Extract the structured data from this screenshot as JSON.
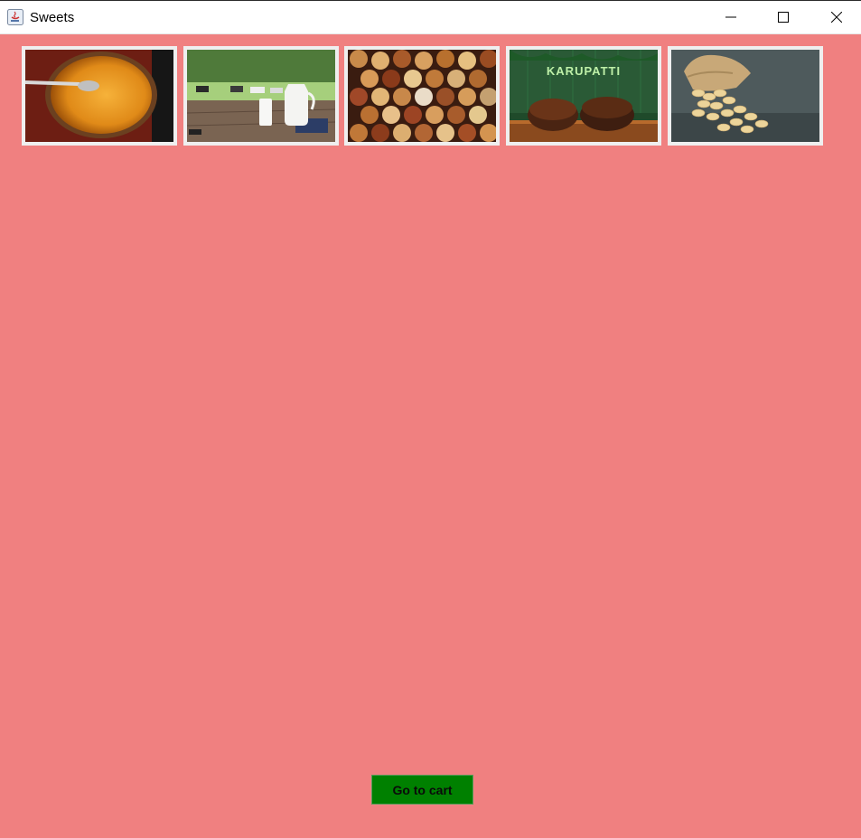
{
  "window": {
    "title": "Sweets",
    "background": "#f08080"
  },
  "thumbnails": [
    {
      "icon": "honey-bowl-image"
    },
    {
      "icon": "milk-farm-image"
    },
    {
      "icon": "dry-fruits-bowls-image"
    },
    {
      "icon": "karupatti-jaggery-image",
      "caption": "KARUPATTI"
    },
    {
      "icon": "cashew-sack-image"
    }
  ],
  "cart_button": {
    "label": "Go to cart",
    "color": "#008000"
  }
}
